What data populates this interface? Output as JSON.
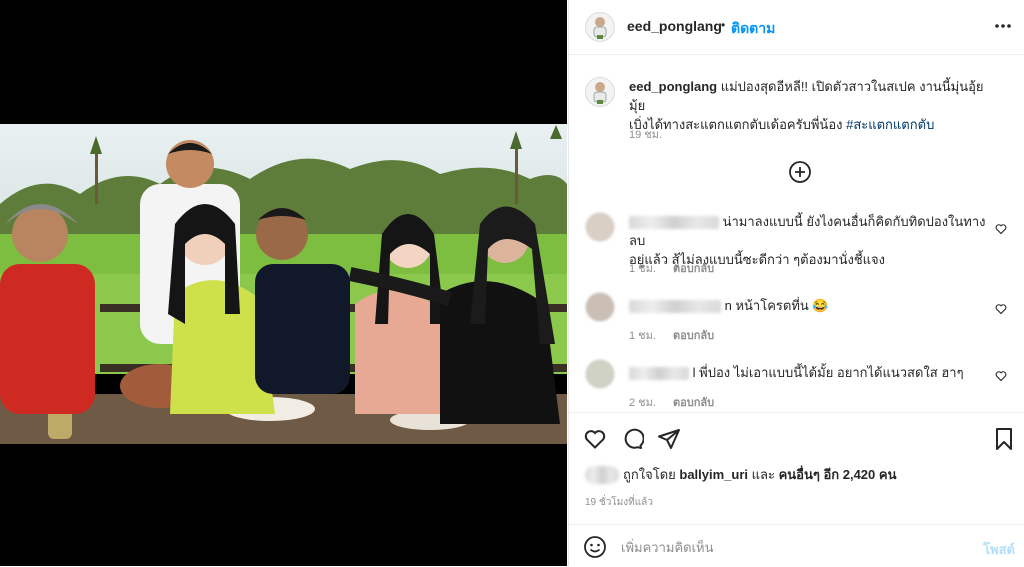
{
  "post": {
    "username": "eed_ponglang",
    "separator": "•",
    "follow_label": "ติดตาม",
    "more_icon": "more-horizontal-icon"
  },
  "caption": {
    "username": "eed_ponglang",
    "text_line1": " แม่ปองสุดอีหลี!! เปิดตัวสาวในสเปค งานนี้มุ่นอุ้ยมุ้ย",
    "text_line2": "เบิ่งได้ทางสะแตกแตกตับเด้อครับพี่น้อง ",
    "hashtag": "#สะแตกแตกตับ",
    "time": "19 ชม."
  },
  "load_more_icon": "plus-circle-icon",
  "comments": [
    {
      "text_line1": "น่ามาลงแบบนี้ ยังไงคนอื่นก็คิดกับทิดปองในทางลบ",
      "text_line2": "อยู่แล้ว สู้ไม่ลงแบบนี้ซะดีกว่า ๆต้องมานั่งชี้แจง",
      "time": "1 ชม.",
      "reply_label": "ตอบกลับ"
    },
    {
      "text_line1": "n หน้าโครตที่น 😂",
      "time": "1 ชม.",
      "reply_label": "ตอบกลับ"
    },
    {
      "text_line1": "l พี่ปอง ไม่เอาแบบนี้ได้มั้ย อยากได้แนวสดใส ฮาๆ",
      "time": "2 ชม.",
      "reply_label": "ตอบกลับ"
    }
  ],
  "likes": {
    "prefix": "ถูกใจโดย ",
    "user": "ballyim_uri",
    "middle": " และ ",
    "others": "คนอื่นๆ อีก 2,420 คน"
  },
  "time_ago": "19 ชั่วโมงที่แล้ว",
  "comment_box": {
    "placeholder": "เพิ่มความคิดเห็น",
    "post_label": "โพสต์"
  },
  "colors": {
    "accent": "#0095f6",
    "hashtag": "#00376b",
    "muted": "#8e8e8e",
    "text": "#262626"
  }
}
